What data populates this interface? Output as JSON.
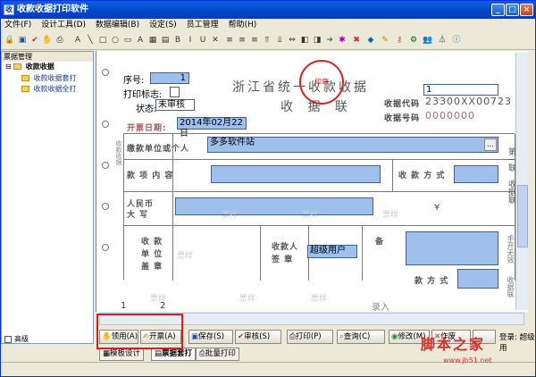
{
  "window": {
    "title": "收款收据打印软件",
    "min": "_",
    "max": "□",
    "close": "×"
  },
  "menu": [
    "文件(F)",
    "设计工具(D)",
    "数据编辑(B)",
    "设定(S)",
    "员工管理",
    "帮助(H)"
  ],
  "toolbar_icons": [
    "lock-icon",
    "save-icon",
    "check-icon",
    "hand-icon",
    "print-icon",
    "text-icon",
    "line-icon",
    "rect-icon",
    "ellipse-icon",
    "bold-icon",
    "image-icon",
    "font-icon",
    "table-icon"
  ],
  "left_panel": {
    "title": "票据管理",
    "root": "收款收据",
    "items": [
      "收款收据套打",
      "收款收据全打"
    ],
    "advanced": "高级"
  },
  "receipt": {
    "title": "浙江省统一收款收据",
    "subtitle": "收  据  联",
    "serial_label": "序号:",
    "serial_value": "1",
    "print_flag_label": "打印标志:",
    "status_label": "状态:",
    "status_value": "未审核",
    "issue_date_label": "开票日期:",
    "issue_date_value": "2014年02月22日",
    "receipt_code_label": "收据代码",
    "receipt_code_value": "23300XX00723",
    "receipt_no_label": "收据号码",
    "receipt_no_value": "0000000",
    "top_right_value": "1",
    "payer_label": "缴款单位或个人",
    "payer_value": "多多软件站",
    "item_label": "款  项  内  容",
    "pay_method_label": "收  款  方  式",
    "rmb_label": "人民币",
    "rmb_label2": "大  写",
    "yen": "¥",
    "org_label": "收 款",
    "org_label2": "单 位",
    "org_label3": "盖 章",
    "receiver_label": "收款人",
    "receiver_label2": "签  章",
    "receiver_value": "超级用户",
    "note_label": "备",
    "note_label2": "注",
    "other_method": "款 方 式",
    "side_text_1": "第一联",
    "side_text_2": "收据联",
    "side_text_3": "手开无效",
    "side_text_4": "收据联",
    "stamp_text": "印章",
    "left_margin_text": "收款收据",
    "watermark_cells": [
      "票样",
      "票样",
      "票样",
      "票样",
      "票样",
      "票样",
      "票样"
    ],
    "entered_text": "录入"
  },
  "bottom_buttons": [
    "领用(A)",
    "开票(A)",
    "保存(S)",
    "审核(S)",
    "打印(P)",
    "查询(C)",
    "修改(M)",
    "作废",
    "..."
  ],
  "marker_1": "1",
  "marker_2": "2",
  "tabs": [
    "模板设计",
    "票据套打",
    "批量打印"
  ],
  "login": "登录: 超级用",
  "watermark": {
    "main": "脚本之家",
    "url": "www.jb51.net"
  },
  "colors": {
    "title_blue": "#0147c7",
    "field_blue": "#9fc0ec",
    "highlight_red": "#e21c1c"
  }
}
